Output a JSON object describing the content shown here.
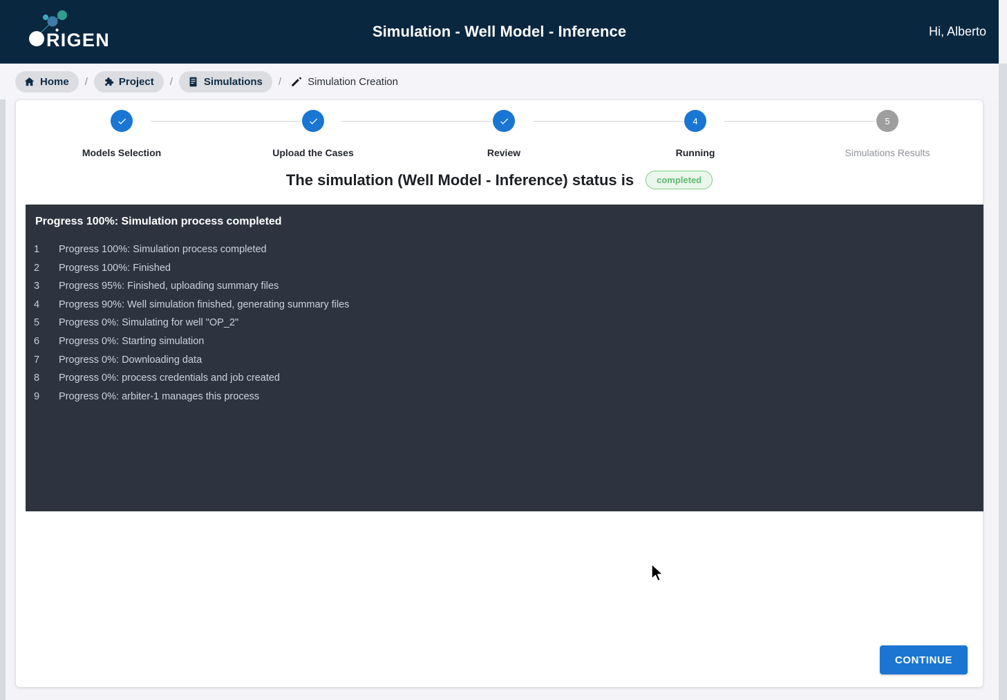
{
  "header": {
    "logo_text": "ORIGEN",
    "logo_icon": "origen-molecule-logo",
    "title": "Simulation - Well Model - Inference",
    "user_greeting": "Hi, Alberto"
  },
  "breadcrumb": {
    "separator": "/",
    "items": [
      {
        "label": "Home",
        "icon": "home-icon",
        "pill": true
      },
      {
        "label": "Project",
        "icon": "puzzle-icon",
        "pill": true
      },
      {
        "label": "Simulations",
        "icon": "document-icon",
        "pill": true
      },
      {
        "label": "Simulation Creation",
        "icon": "pencil-icon",
        "pill": false
      }
    ]
  },
  "stepper": {
    "steps": [
      {
        "number": "1",
        "label": "Models Selection",
        "state": "completed",
        "icon": "check-icon"
      },
      {
        "number": "2",
        "label": "Upload the Cases",
        "state": "completed",
        "icon": "check-icon"
      },
      {
        "number": "3",
        "label": "Review",
        "state": "completed",
        "icon": "check-icon"
      },
      {
        "number": "4",
        "label": "Running",
        "state": "active",
        "icon": ""
      },
      {
        "number": "5",
        "label": "Simulations Results",
        "state": "pending",
        "icon": ""
      }
    ],
    "active_color": "#1976d2",
    "pending_color": "#9e9e9e"
  },
  "status": {
    "text": "The simulation (Well Model - Inference) status is",
    "badge": "completed",
    "badge_color": "#62b96f",
    "badge_bg": "#eaf7ec"
  },
  "console": {
    "title": "Progress 100%: Simulation process completed",
    "lines": [
      {
        "n": "1",
        "text": "Progress 100%: Simulation process completed"
      },
      {
        "n": "2",
        "text": "Progress 100%: Finished"
      },
      {
        "n": "3",
        "text": "Progress 95%: Finished, uploading summary files"
      },
      {
        "n": "4",
        "text": "Progress 90%: Well simulation finished, generating summary files"
      },
      {
        "n": "5",
        "text": "Progress 0%: Simulating for well \"OP_2\""
      },
      {
        "n": "6",
        "text": "Progress 0%: Starting simulation"
      },
      {
        "n": "7",
        "text": "Progress 0%: Downloading data"
      },
      {
        "n": "8",
        "text": "Progress 0%: process credentials and job created"
      },
      {
        "n": "9",
        "text": "Progress 0%: arbiter-1 manages this process"
      }
    ],
    "background": "#2d3440"
  },
  "footer": {
    "continue_label": "CONTINUE",
    "continue_color": "#1a76d2"
  }
}
